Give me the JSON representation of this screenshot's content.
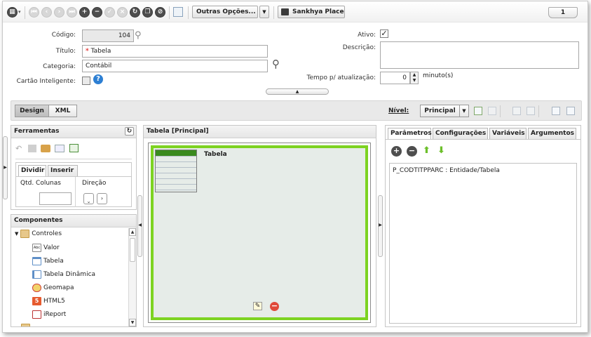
{
  "toolbar": {
    "more_options_label": "Outras Opções...",
    "place_label": "Sankhya Place",
    "page_number": "1"
  },
  "form": {
    "codigo_label": "Código:",
    "codigo_value": "104",
    "titulo_label": "Título:",
    "titulo_required": "*",
    "titulo_value": "Tabela",
    "categoria_label": "Categoria:",
    "categoria_value": "Contábil",
    "cartao_label": "Cartão Inteligente:",
    "help_glyph": "?",
    "ativo_label": "Ativo:",
    "ativo_check": "✓",
    "descricao_label": "Descrição:",
    "descricao_value": "",
    "tempo_label": "Tempo p/ atualização:",
    "tempo_value": "0",
    "tempo_unit": "minuto(s)"
  },
  "designbar": {
    "design_label": "Design",
    "xml_label": "XML",
    "nivel_label": "Nível:",
    "nivel_value": "Principal"
  },
  "ferramentas": {
    "title": "Ferramentas",
    "refresh_glyph": "↻",
    "tab_dividir": "Dividir",
    "tab_inserir": "Inserir",
    "qtd_colunas_label": "Qtd. Colunas",
    "qtd_colunas_value": "",
    "direcao_label": "Direção"
  },
  "componentes": {
    "title": "Componentes",
    "root": "Controles",
    "items": [
      {
        "label": "Valor",
        "icon": "value-icon"
      },
      {
        "label": "Tabela",
        "icon": "table-icon"
      },
      {
        "label": "Tabela Dinâmica",
        "icon": "pivot-table-icon"
      },
      {
        "label": "Geomapa",
        "icon": "geomap-icon"
      },
      {
        "label": "HTML5",
        "icon": "html5-icon"
      },
      {
        "label": "iReport",
        "icon": "ireport-icon"
      }
    ]
  },
  "canvas": {
    "title": "Tabela [Principal]",
    "component_label": "Tabela"
  },
  "right_panel": {
    "tabs": [
      "Parâmetros",
      "Configurações",
      "Variáveis",
      "Argumentos"
    ],
    "parameter": "P_CODTITPPARC : Entidade/Tabela"
  },
  "colors": {
    "accent_green": "#7dd321",
    "table_header_green": "#3a8a1e",
    "help_blue": "#2d7fd3",
    "remove_red": "#e04a3a"
  }
}
